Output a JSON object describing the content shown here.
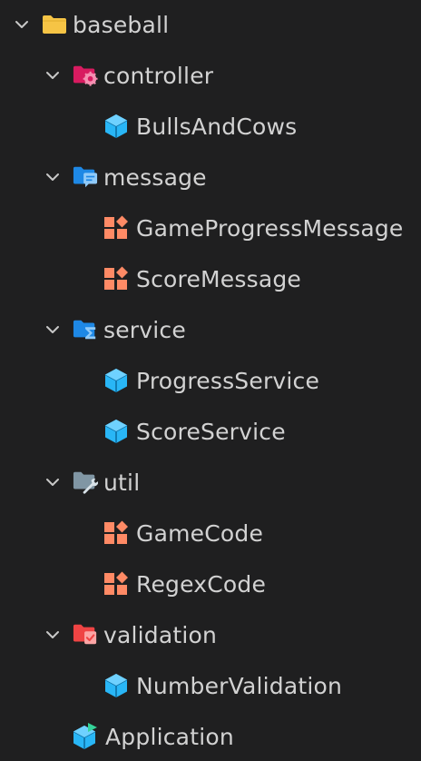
{
  "tree": {
    "root": {
      "label": "baseball",
      "icon": "folder-icon"
    },
    "folders": [
      {
        "label": "controller",
        "icon": "controller-folder-icon"
      },
      {
        "label": "message",
        "icon": "message-folder-icon"
      },
      {
        "label": "service",
        "icon": "service-folder-icon"
      },
      {
        "label": "util",
        "icon": "util-folder-icon"
      },
      {
        "label": "validation",
        "icon": "validation-folder-icon"
      }
    ],
    "files": {
      "bulls_and_cows": "BullsAndCows",
      "game_progress_message": "GameProgressMessage",
      "score_message": "ScoreMessage",
      "progress_service": "ProgressService",
      "score_service": "ScoreService",
      "game_code": "GameCode",
      "regex_code": "RegexCode",
      "number_validation": "NumberValidation",
      "application": "Application"
    }
  },
  "colors": {
    "background": "#1f1f20",
    "text": "#d2d2d2",
    "class_icon": "#29b6f6",
    "enum_icon": "#ff8a65",
    "root_folder": "#f6c445",
    "controller_folder": "#d81b60",
    "service_folder": "#1e88e5",
    "util_folder": "#8096a4",
    "validation_folder": "#ef4444"
  }
}
